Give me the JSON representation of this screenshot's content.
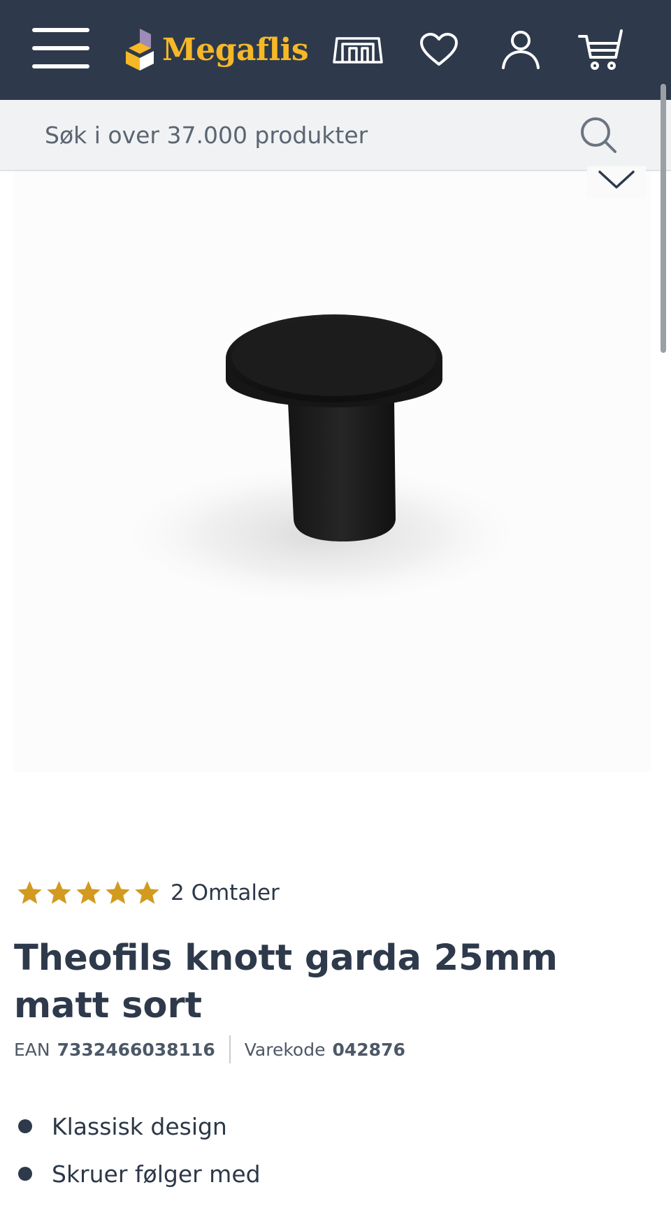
{
  "header": {
    "logo_text": "Megaflis",
    "brand_color": "#f6b827",
    "background_color": "#2e3a4b",
    "icons": [
      "menu-icon",
      "showroom-icon",
      "heart-icon",
      "user-icon",
      "cart-icon"
    ]
  },
  "search": {
    "placeholder": "Søk i over 37.000 produkter",
    "icon": "search-icon"
  },
  "gallery": {
    "toggle_icon": "chevron-down-icon"
  },
  "product": {
    "rating": 5,
    "rating_max": 5,
    "reviews_label": "2 Omtaler",
    "title": "Theofils knott garda 25mm matt sort",
    "ean_label": "EAN",
    "ean": "7332466038116",
    "sku_label": "Varekode",
    "sku": "042876",
    "features": [
      "Klassisk design",
      "Skruer følger med"
    ]
  },
  "colors": {
    "star": "#d29a1f",
    "text": "#2e3a4b"
  }
}
